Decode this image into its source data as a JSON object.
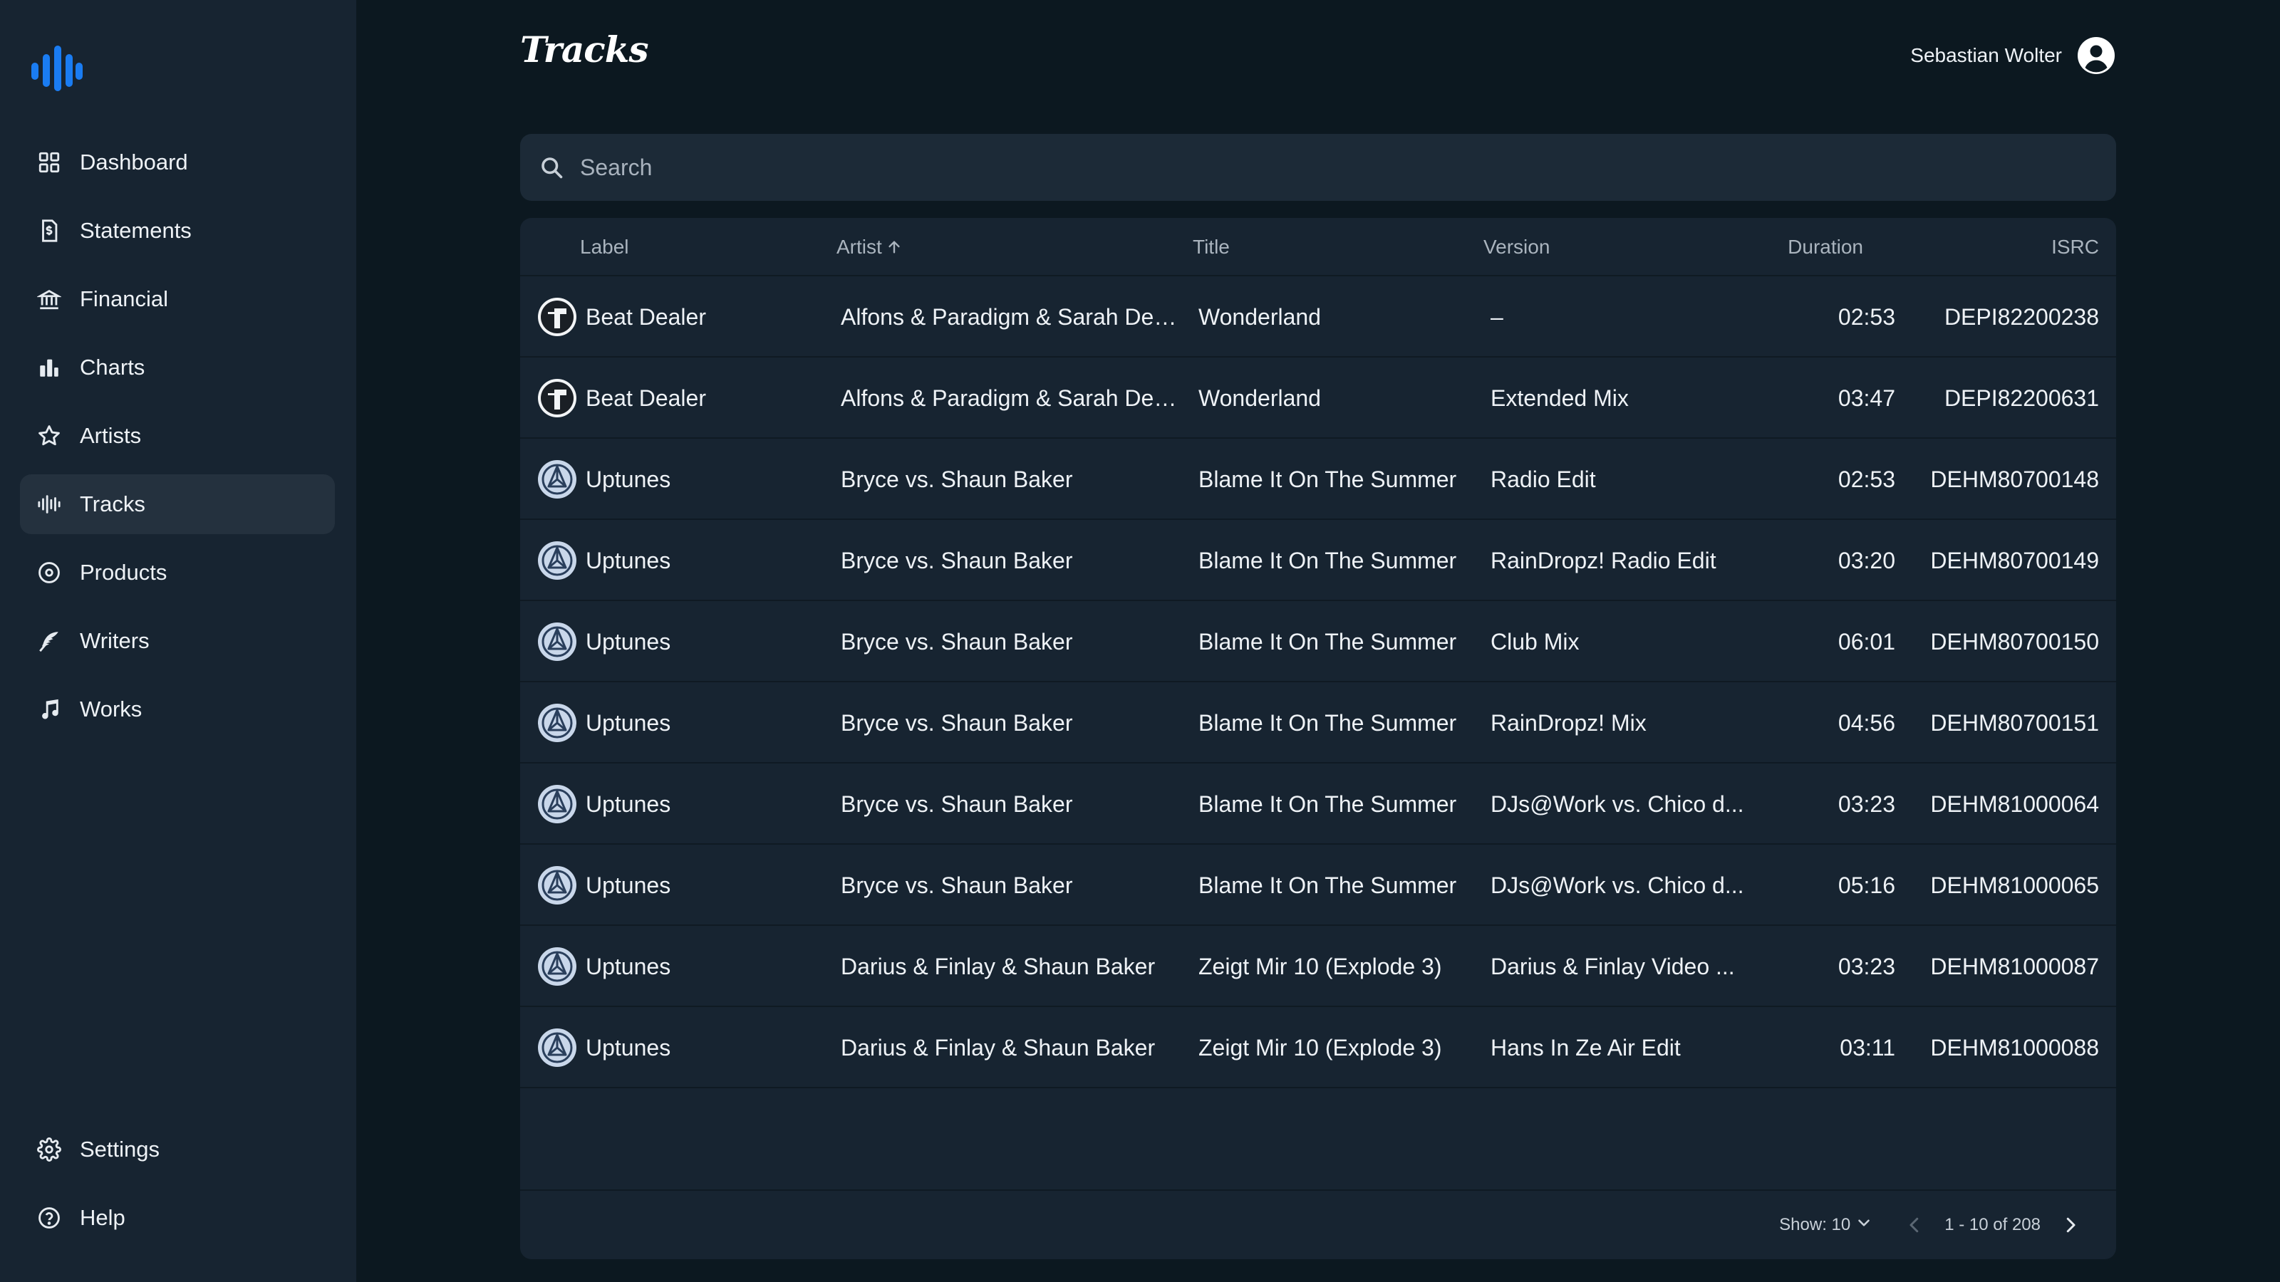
{
  "app": {
    "brand_color": "#1a7cf2"
  },
  "sidebar": {
    "items": [
      {
        "label": "Dashboard",
        "icon": "grid-icon"
      },
      {
        "label": "Statements",
        "icon": "dollar-document-icon"
      },
      {
        "label": "Financial",
        "icon": "bank-icon"
      },
      {
        "label": "Charts",
        "icon": "bar-chart-icon"
      },
      {
        "label": "Artists",
        "icon": "star-icon"
      },
      {
        "label": "Tracks",
        "icon": "waveform-icon",
        "active": true
      },
      {
        "label": "Products",
        "icon": "disc-icon"
      },
      {
        "label": "Writers",
        "icon": "feather-icon"
      },
      {
        "label": "Works",
        "icon": "music-note-icon"
      }
    ],
    "bottom": [
      {
        "label": "Settings",
        "icon": "gear-icon"
      },
      {
        "label": "Help",
        "icon": "help-circle-icon"
      }
    ]
  },
  "header": {
    "title": "Tracks",
    "user_name": "Sebastian Wolter"
  },
  "search": {
    "placeholder": "Search",
    "value": ""
  },
  "table": {
    "columns": {
      "label": "Label",
      "artist": "Artist",
      "title": "Title",
      "version": "Version",
      "duration": "Duration",
      "isrc": "ISRC"
    },
    "sorted_by": "artist",
    "sort_direction": "ascending",
    "rows": [
      {
        "label": "Beat Dealer",
        "logo": "beat-dealer-logo",
        "artist": "Alfons & Paradigm & Sarah De W...",
        "title": "Wonderland",
        "version": "–",
        "duration": "02:53",
        "isrc": "DEPI82200238"
      },
      {
        "label": "Beat Dealer",
        "logo": "beat-dealer-logo",
        "artist": "Alfons & Paradigm & Sarah De W...",
        "title": "Wonderland",
        "version": "Extended Mix",
        "duration": "03:47",
        "isrc": "DEPI82200631"
      },
      {
        "label": "Uptunes",
        "logo": "uptunes-logo",
        "artist": "Bryce vs. Shaun Baker",
        "title": "Blame It On The Summer",
        "version": "Radio Edit",
        "duration": "02:53",
        "isrc": "DEHM80700148"
      },
      {
        "label": "Uptunes",
        "logo": "uptunes-logo",
        "artist": "Bryce vs. Shaun Baker",
        "title": "Blame It On The Summer",
        "version": "RainDropz! Radio Edit",
        "duration": "03:20",
        "isrc": "DEHM80700149"
      },
      {
        "label": "Uptunes",
        "logo": "uptunes-logo",
        "artist": "Bryce vs. Shaun Baker",
        "title": "Blame It On The Summer",
        "version": "Club Mix",
        "duration": "06:01",
        "isrc": "DEHM80700150"
      },
      {
        "label": "Uptunes",
        "logo": "uptunes-logo",
        "artist": "Bryce vs. Shaun Baker",
        "title": "Blame It On The Summer",
        "version": "RainDropz! Mix",
        "duration": "04:56",
        "isrc": "DEHM80700151"
      },
      {
        "label": "Uptunes",
        "logo": "uptunes-logo",
        "artist": "Bryce vs. Shaun Baker",
        "title": "Blame It On The Summer",
        "version": "DJs@Work vs. Chico d...",
        "duration": "03:23",
        "isrc": "DEHM81000064"
      },
      {
        "label": "Uptunes",
        "logo": "uptunes-logo",
        "artist": "Bryce vs. Shaun Baker",
        "title": "Blame It On The Summer",
        "version": "DJs@Work vs. Chico d...",
        "duration": "05:16",
        "isrc": "DEHM81000065"
      },
      {
        "label": "Uptunes",
        "logo": "uptunes-logo",
        "artist": "Darius & Finlay & Shaun Baker",
        "title": "Zeigt Mir 10 (Explode 3)",
        "version": "Darius & Finlay Video ...",
        "duration": "03:23",
        "isrc": "DEHM81000087"
      },
      {
        "label": "Uptunes",
        "logo": "uptunes-logo",
        "artist": "Darius & Finlay & Shaun Baker",
        "title": "Zeigt Mir 10 (Explode 3)",
        "version": "Hans In Ze Air Edit",
        "duration": "03:11",
        "isrc": "DEHM81000088"
      }
    ]
  },
  "pagination": {
    "show_label": "Show: 10",
    "range": "1 - 10 of 208"
  }
}
